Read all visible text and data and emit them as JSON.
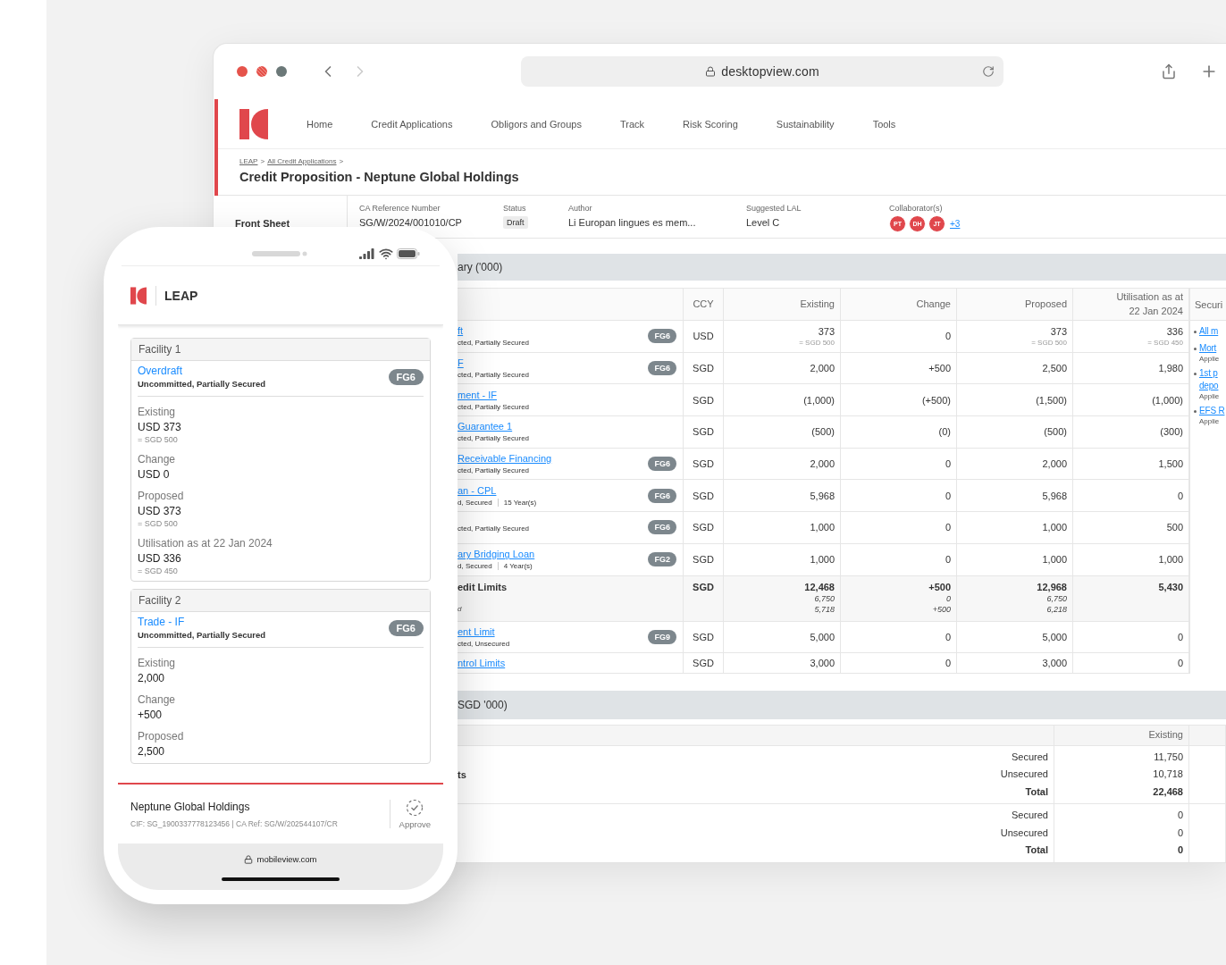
{
  "browser": {
    "url": "desktopview.com"
  },
  "nav": {
    "items": [
      "Home",
      "Credit Applications",
      "Obligors and Groups",
      "Track",
      "Risk Scoring",
      "Sustainability",
      "Tools"
    ]
  },
  "header": {
    "breadcrumb": [
      "LEAP",
      "All Credit Applications"
    ],
    "separator": ">",
    "title": "Credit Proposition - Neptune Global Holdings"
  },
  "sidebar": {
    "items": [
      "Front Sheet"
    ]
  },
  "meta": [
    {
      "kind": "text",
      "label": "CA Reference Number",
      "value": "SG/W/2024/001010/CP"
    },
    {
      "kind": "badge",
      "label": "Status",
      "value": "Draft"
    },
    {
      "kind": "text",
      "label": "Author",
      "value": "Li Europan lingues es mem..."
    },
    {
      "kind": "text",
      "label": "Suggested LAL",
      "value": "Level C"
    },
    {
      "kind": "avatars",
      "label": "Collaborator(s)",
      "avatars": [
        "PT",
        "DH",
        "JT"
      ],
      "more": "+3"
    }
  ],
  "facility_summary": {
    "title": "ary ('000)",
    "columns": [
      "CCY",
      "Existing",
      "Change",
      "Proposed",
      "Utilisation as at 22 Jan 2024"
    ],
    "rows": [
      {
        "kind": "facility",
        "name": "ft",
        "sub": "cted, Partially Secured",
        "badge": "FG6",
        "ccy": "USD",
        "values": [
          {
            "value": "373",
            "sub": "= SGD 500"
          },
          {
            "value": "0"
          },
          {
            "value": "373",
            "sub": "= SGD 500"
          },
          {
            "value": "336",
            "sub": "= SGD 450"
          }
        ]
      },
      {
        "kind": "facility",
        "name": "F",
        "sub": "cted, Partially Secured",
        "badge": "FG6",
        "ccy": "SGD",
        "values": [
          {
            "value": "2,000"
          },
          {
            "value": "+500"
          },
          {
            "value": "2,500"
          },
          {
            "value": "1,980"
          }
        ]
      },
      {
        "kind": "facility",
        "name": "ment - IF",
        "sub": "cted, Partially Secured",
        "ccy": "SGD",
        "values": [
          {
            "value": "(1,000)"
          },
          {
            "value": "(+500)"
          },
          {
            "value": "(1,500)"
          },
          {
            "value": "(1,000)"
          }
        ]
      },
      {
        "kind": "facility",
        "name": "Guarantee 1",
        "sub": "cted, Partially Secured",
        "ccy": "SGD",
        "values": [
          {
            "value": "(500)"
          },
          {
            "value": "(0)"
          },
          {
            "value": "(500)"
          },
          {
            "value": "(300)"
          }
        ]
      },
      {
        "kind": "facility",
        "name": "Receivable Financing",
        "sub": "cted, Partially Secured",
        "badge": "FG6",
        "ccy": "SGD",
        "values": [
          {
            "value": "2,000"
          },
          {
            "value": "0"
          },
          {
            "value": "2,000"
          },
          {
            "value": "1,500"
          }
        ]
      },
      {
        "kind": "facility",
        "name": "an - CPL",
        "sub": "d, Secured",
        "tenor": "15 Year(s)",
        "badge": "FG6",
        "ccy": "SGD",
        "values": [
          {
            "value": "5,968"
          },
          {
            "value": "0"
          },
          {
            "value": "5,968"
          },
          {
            "value": "0"
          }
        ]
      },
      {
        "kind": "facility",
        "sub": "cted, Partially Secured",
        "badge": "FG6",
        "ccy": "SGD",
        "values": [
          {
            "value": "1,000"
          },
          {
            "value": "0"
          },
          {
            "value": "1,000"
          },
          {
            "value": "500"
          }
        ]
      },
      {
        "kind": "facility",
        "name": "ary Bridging Loan",
        "sub": "d, Secured",
        "tenor": "4 Year(s)",
        "badge": "FG2",
        "ccy": "SGD",
        "values": [
          {
            "value": "1,000"
          },
          {
            "value": "0"
          },
          {
            "value": "1,000"
          },
          {
            "value": "1,000"
          }
        ]
      },
      {
        "kind": "total",
        "name": "edit Limits",
        "note": "d",
        "ccy": "SGD",
        "values": [
          {
            "value": "12,468",
            "lines": [
              "6,750",
              "5,718"
            ]
          },
          {
            "value": "+500",
            "lines": [
              "0",
              "+500"
            ]
          },
          {
            "value": "12,968",
            "lines": [
              "6,750",
              "6,218"
            ]
          },
          {
            "value": "5,430"
          }
        ]
      },
      {
        "kind": "facility",
        "name": "ent Limit",
        "sub": "cted, Unsecured",
        "badge": "FG9",
        "ccy": "SGD",
        "values": [
          {
            "value": "5,000"
          },
          {
            "value": "0"
          },
          {
            "value": "5,000"
          },
          {
            "value": "0"
          }
        ]
      },
      {
        "kind": "facility",
        "name": "ntrol Limits",
        "ccy": "SGD",
        "values": [
          {
            "value": "3,000"
          },
          {
            "value": "0"
          },
          {
            "value": "3,000"
          },
          {
            "value": "0"
          }
        ]
      }
    ],
    "securities": {
      "header": "Securi",
      "items": [
        {
          "lines": [
            "All m"
          ]
        },
        {
          "lines": [
            "Mort"
          ],
          "note": "Applie"
        },
        {
          "lines": [
            "1st p",
            "depo"
          ],
          "note": "Applie"
        },
        {
          "lines": [
            "EFS R"
          ],
          "note": "Applie"
        }
      ]
    }
  },
  "exposure": {
    "title": "SGD '000)",
    "columns": [
      "Existing"
    ],
    "groups": [
      {
        "label": "ts",
        "rows": [
          {
            "kind": "normal",
            "label": "Secured",
            "value": "11,750"
          },
          {
            "kind": "normal",
            "label": "Unsecured",
            "value": "10,718"
          },
          {
            "kind": "total",
            "label": "Total",
            "value": "22,468"
          }
        ]
      },
      {
        "rows": [
          {
            "kind": "normal",
            "label": "Secured",
            "value": "0"
          },
          {
            "kind": "normal",
            "label": "Unsecured",
            "value": "0"
          },
          {
            "kind": "total",
            "label": "Total",
            "value": "0"
          }
        ]
      }
    ]
  },
  "mobile": {
    "app_name": "LEAP",
    "facilities": [
      {
        "title": "Facility 1",
        "name": "Overdraft",
        "sub": "Uncommitted, Partially Secured",
        "badge": "FG6",
        "fields": [
          {
            "label": "Existing",
            "value": "USD 373",
            "sub": "= SGD 500"
          },
          {
            "label": "Change",
            "value": "USD 0"
          },
          {
            "label": "Proposed",
            "value": "USD 373",
            "sub": "= SGD 500"
          },
          {
            "label": "Utilisation as at 22 Jan 2024",
            "value": "USD 336",
            "sub": "= SGD 450"
          }
        ]
      },
      {
        "title": "Facility 2",
        "name": "Trade - IF",
        "sub": "Uncommitted, Partially Secured",
        "badge": "FG6",
        "fields": [
          {
            "label": "Existing",
            "value": "2,000"
          },
          {
            "label": "Change",
            "value": "+500"
          },
          {
            "label": "Proposed",
            "value": "2,500"
          }
        ]
      }
    ],
    "footer": {
      "name": "Neptune Global Holdings",
      "details": "CIF: SG_1900337778123456 | CA Ref: SG/W/202544107/CR",
      "action": "Approve"
    },
    "url": "mobileview.com"
  }
}
